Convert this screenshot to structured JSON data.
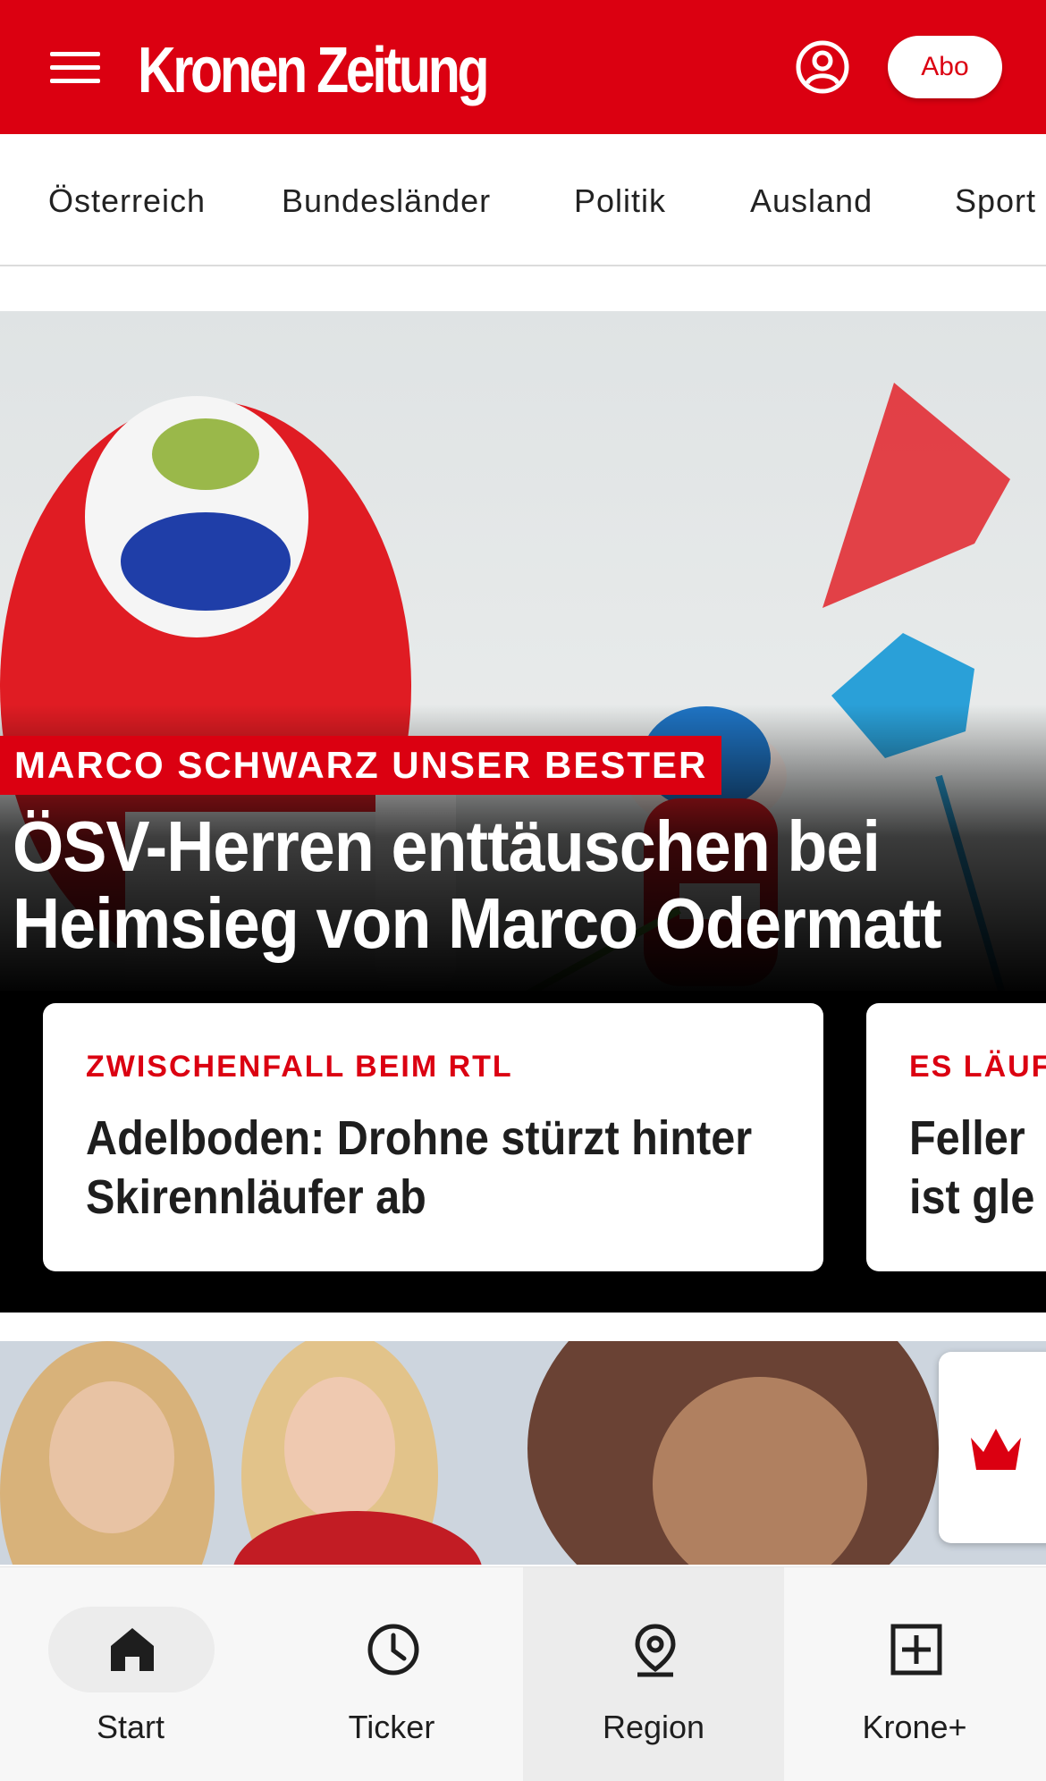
{
  "header": {
    "logo_text": "Kronen Zeitung",
    "abo_label": "Abo"
  },
  "categories": [
    "Österreich",
    "Bundesländer",
    "Politik",
    "Ausland",
    "Sport"
  ],
  "hero": {
    "kicker": "MARCO SCHWARZ UNSER BESTER",
    "headline": "ÖSV-Herren enttäuschen bei Heimsieg von Marco Odermatt"
  },
  "cards": [
    {
      "kicker": "ZWISCHENFALL BEIM RTL",
      "title": "Adelboden: Drohne stürzt hinter Skirennläufer ab"
    },
    {
      "kicker": "ES LÄUF",
      "title": "Feller ist gle"
    }
  ],
  "bottom_nav": [
    {
      "label": "Start",
      "icon": "home-icon"
    },
    {
      "label": "Ticker",
      "icon": "clock-icon"
    },
    {
      "label": "Region",
      "icon": "location-pin-icon"
    },
    {
      "label": "Krone+",
      "icon": "plus-box-icon"
    }
  ],
  "colors": {
    "brand_red": "#db0011",
    "nav_background": "#f7f7f7"
  }
}
